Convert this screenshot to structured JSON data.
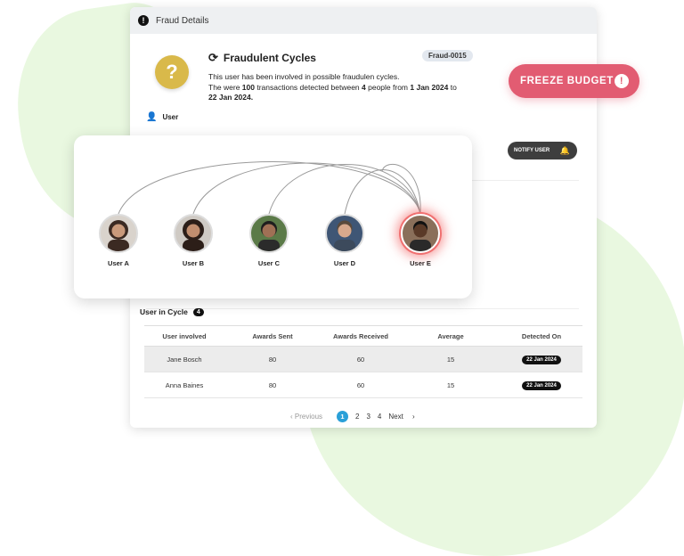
{
  "panel": {
    "header_title": "Fraud Details",
    "cycle_title": "Fraudulent Cycles",
    "fraud_tag": "Fraud-0015",
    "desc_line1": "This user has been involved in possible fraudulen cycles.",
    "desc_prefix": "The were ",
    "desc_count": "100",
    "desc_mid": " transactions detected between ",
    "desc_people": "4",
    "desc_mid2": " people from ",
    "desc_from": "1 Jan 2024",
    "desc_to_word": " to",
    "desc_to": "22 Jan 2024.",
    "user_label": "User",
    "notify_label": "NOTIFY USER"
  },
  "freeze": {
    "label": "FREEZE BUDGET"
  },
  "graph": {
    "nodes": [
      {
        "name": "User A",
        "skin": "#c99a7b",
        "hair": "#3b2a22",
        "bg": "#d9d3cc"
      },
      {
        "name": "User B",
        "skin": "#c18e6f",
        "hair": "#2c1e18",
        "bg": "#cfcac4"
      },
      {
        "name": "User C",
        "skin": "#a07055",
        "hair": "#1e1e1e",
        "bg": "#5b7a48"
      },
      {
        "name": "User D",
        "skin": "#d8a98d",
        "hair": "#5a4a3c",
        "bg": "#3f5675"
      },
      {
        "name": "User E",
        "skin": "#5a3a28",
        "hair": "#111111",
        "bg": "#8a6f5a"
      }
    ]
  },
  "cycle_section": {
    "label": "User in Cycle",
    "count": "4"
  },
  "table": {
    "headers": [
      "User involved",
      "Awards Sent",
      "Awards Received",
      "Average",
      "Detected On"
    ],
    "rows": [
      [
        "Jane Bosch",
        "80",
        "60",
        "15",
        "22 Jan 2024"
      ],
      [
        "Anna Baines",
        "80",
        "60",
        "15",
        "22 Jan 2024"
      ]
    ]
  },
  "pagination": {
    "prev": "Previous",
    "pages": [
      "1",
      "2",
      "3",
      "4"
    ],
    "next": "Next",
    "current": "1"
  },
  "colors": {
    "freeze": "#e25c72",
    "page_active": "#2aa0d8",
    "question": "#d9b94a",
    "blob": "#e9f8e0"
  }
}
